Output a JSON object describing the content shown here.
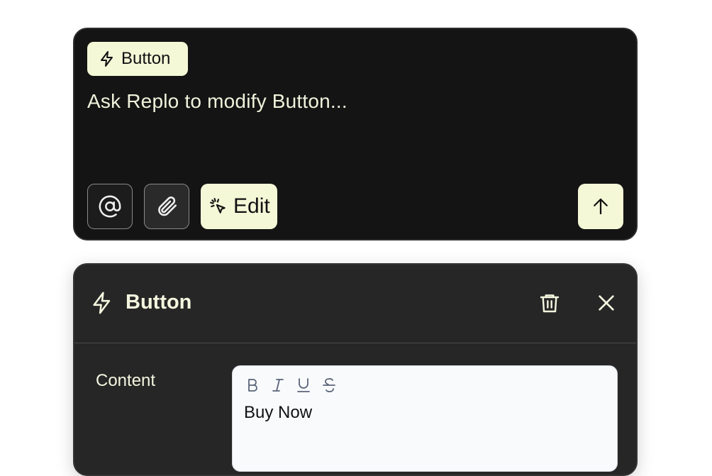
{
  "prompt": {
    "chip_label": "Button",
    "placeholder": "Ask Replo to modify Button...",
    "edit_label": "Edit",
    "tools": [
      {
        "icon": "at-sign-icon"
      },
      {
        "icon": "paperclip-icon"
      }
    ],
    "send_icon": "arrow-up-icon"
  },
  "panel": {
    "title": "Button",
    "title_icon": "lightning-bolt-icon",
    "actions": [
      "trash-icon",
      "close-icon"
    ],
    "content_label": "Content",
    "editor": {
      "value": "Buy Now",
      "toolbar": [
        "bold",
        "italic",
        "underline",
        "strikethrough"
      ]
    }
  },
  "colors": {
    "accent": "#f4f8d7",
    "prompt_bg": "#141414",
    "panel_bg": "#262626",
    "editor_bg": "#f8fafc"
  }
}
